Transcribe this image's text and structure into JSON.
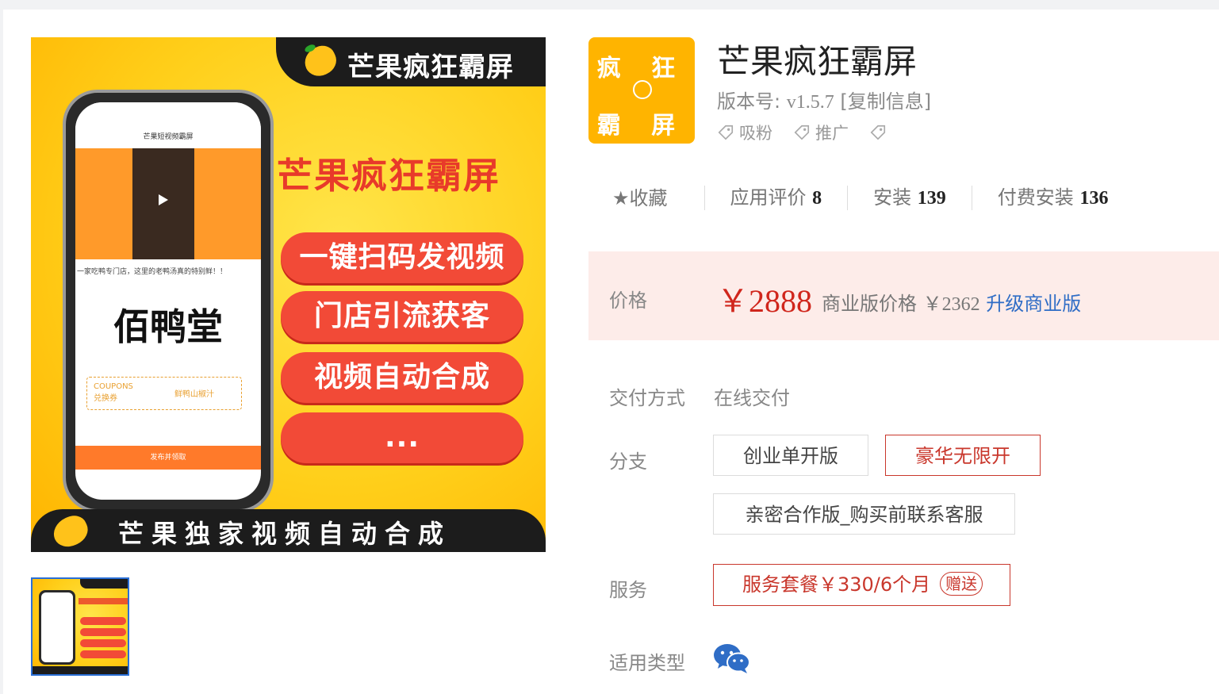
{
  "hero": {
    "top_banner": "芒果疯狂霸屏",
    "title": "芒果疯狂霸屏",
    "pills": [
      "一键扫码发视频",
      "门店引流获客",
      "视频自动合成",
      "..."
    ],
    "bottom_banner": "芒果独家视频自动合成",
    "phone": {
      "header": "芒果短视频霸屏",
      "caption": "一家吃鸭专门店，这里的老鸭汤真的特别鲜！！",
      "logo": "佰鸭堂",
      "coupon_title": "COUPONS",
      "coupon_sub": "兑换券",
      "coupon_right": "鲜鸭山椒汁",
      "publish": "发布并领取"
    }
  },
  "app": {
    "icon_text_top": "疯 狂",
    "icon_text_bottom": "霸 屏",
    "name": "芒果疯狂霸屏",
    "version_label": "版本号:",
    "version": "v1.5.7",
    "copy_info": "[复制信息]",
    "tags": [
      "吸粉",
      "推广",
      ""
    ]
  },
  "stats": {
    "favorite": "★收藏",
    "rating_label": "应用评价",
    "rating": "8",
    "installs_label": "安装",
    "installs": "139",
    "paid_label": "付费安装",
    "paid": "136"
  },
  "price": {
    "label": "价格",
    "value": "￥2888",
    "biz_label": "商业版价格",
    "biz_value": "￥2362",
    "upgrade": "升级商业版"
  },
  "delivery": {
    "label": "交付方式",
    "value": "在线交付"
  },
  "branch": {
    "label": "分支",
    "options": [
      "创业单开版",
      "豪华无限开",
      "亲密合作版_购买前联系客服"
    ],
    "selected_index": 1
  },
  "service": {
    "label": "服务",
    "value": "服务套餐￥330/6个月",
    "badge": "赠送"
  },
  "type": {
    "label": "适用类型",
    "icon": "wechat-icon"
  },
  "colors": {
    "accent_red": "#c9372c",
    "price_red": "#d0261c",
    "link_blue": "#2f6dc6",
    "brand_yellow": "#ffb400"
  }
}
